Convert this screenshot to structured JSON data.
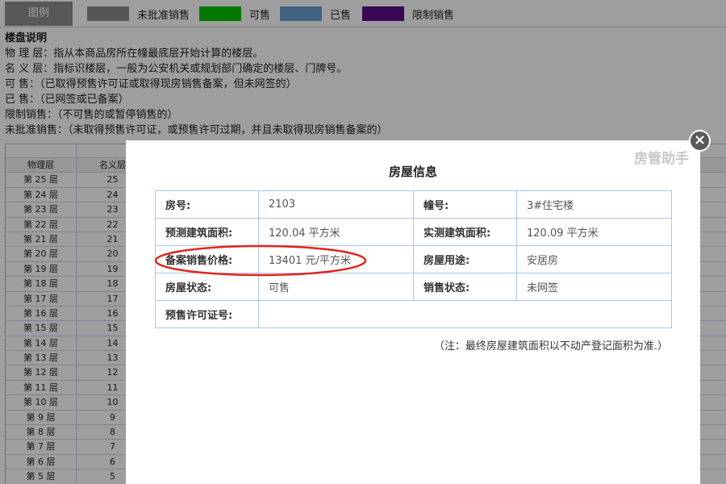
{
  "legend": {
    "tag": "图例",
    "items": [
      {
        "label": "未批准销售",
        "color": "#8c8c8c"
      },
      {
        "label": "可售",
        "color": "#00c000"
      },
      {
        "label": "已售",
        "color": "#6a9ed0"
      },
      {
        "label": "限制销售",
        "color": "#5a0c8c"
      }
    ]
  },
  "notes": {
    "heading": "楼盘说明",
    "lines": [
      "物 理 层：指从本商品房所在幢最底层开始计算的楼层。",
      "名 义 层：指标识楼层，一般为公安机关或规划部门确定的楼层、门牌号。",
      "可 售：（已取得预售许可证或取得现房销售备案，但未网签的）",
      "已 售：（已网签或已备案）",
      "限制销售：（不可售的或暂停销售的）",
      "未批准销售：（未取得预售许可证，或预售许可过期，并且未取得现房销售备案的）"
    ]
  },
  "floor_table": {
    "headers": [
      "物理层",
      "名义层"
    ],
    "rows": [
      [
        "第 25 层",
        "25"
      ],
      [
        "第 24 层",
        "24"
      ],
      [
        "第 23 层",
        "23"
      ],
      [
        "第 22 层",
        "22"
      ],
      [
        "第 21 层",
        "21"
      ],
      [
        "第 20 层",
        "20"
      ],
      [
        "第 19 层",
        "19"
      ],
      [
        "第 18 层",
        "18"
      ],
      [
        "第 17 层",
        "17"
      ],
      [
        "第 16 层",
        "16"
      ],
      [
        "第 15 层",
        "15"
      ],
      [
        "第 14 层",
        "14"
      ],
      [
        "第 13 层",
        "13"
      ],
      [
        "第 12 层",
        "12"
      ],
      [
        "第 11 层",
        "11"
      ],
      [
        "第 10 层",
        "10"
      ],
      [
        "第 9 层",
        "9"
      ],
      [
        "第 8 层",
        "8"
      ],
      [
        "第 7 层",
        "7"
      ],
      [
        "第 6 层",
        "6"
      ],
      [
        "第 5 层",
        "5"
      ]
    ]
  },
  "modal": {
    "watermark": "房管助手",
    "close_glyph": "×",
    "title": "房屋信息",
    "rows": [
      {
        "k1": "房号:",
        "v1": "2103",
        "k2": "幢号:",
        "v2": "3#住宅楼"
      },
      {
        "k1": "预测建筑面积:",
        "v1": "120.04 平方米",
        "k2": "实测建筑面积:",
        "v2": "120.09 平方米"
      },
      {
        "k1": "备案销售价格:",
        "v1": "13401 元/平方米",
        "k2": "房屋用途:",
        "v2": "安居房"
      },
      {
        "k1": "房屋状态:",
        "v1": "可售",
        "k2": "销售状态:",
        "v2": "未网签"
      }
    ],
    "permit_label": "预售许可证号:",
    "permit_value": "",
    "note": "（注：最终房屋建筑面积以不动产登记面积为准.）"
  }
}
